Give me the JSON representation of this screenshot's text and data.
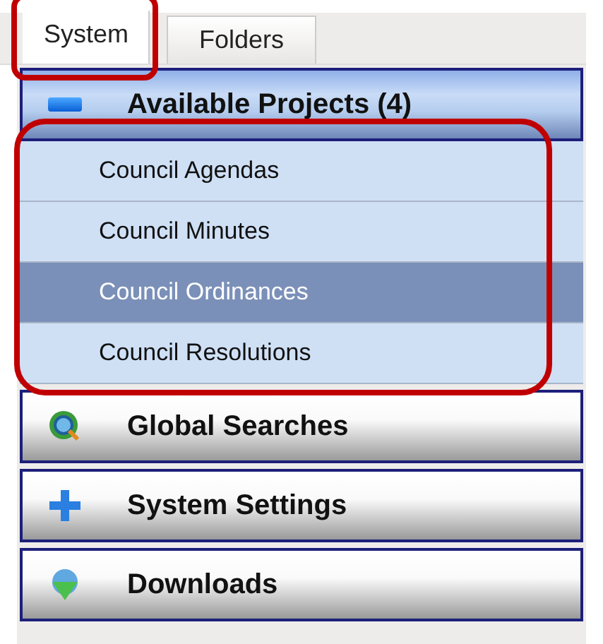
{
  "tabs": [
    {
      "label": "System",
      "selected": true,
      "highlighted": true
    },
    {
      "label": "Folders",
      "selected": false,
      "highlighted": false
    }
  ],
  "sections": [
    {
      "title": "Available Projects (4)",
      "kind": "projects",
      "expanded": true,
      "highlighted": true,
      "items": [
        {
          "label": "Council Agendas",
          "selected": false
        },
        {
          "label": "Council Minutes",
          "selected": false
        },
        {
          "label": "Council Ordinances",
          "selected": true
        },
        {
          "label": "Council Resolutions",
          "selected": false
        }
      ]
    },
    {
      "title": "Global Searches",
      "kind": "search",
      "expanded": false
    },
    {
      "title": "System Settings",
      "kind": "settings",
      "expanded": false
    },
    {
      "title": "Downloads",
      "kind": "downloads",
      "expanded": false
    }
  ]
}
